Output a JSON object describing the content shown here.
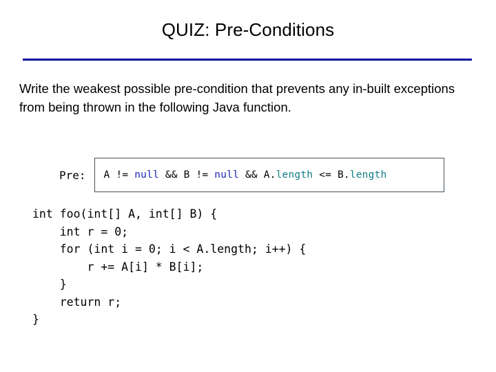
{
  "slide": {
    "title": "QUIZ: Pre-Conditions",
    "rule_color": "#0a0aa0",
    "prompt": "Write the weakest possible pre-condition that prevents any in-built exceptions from being thrown in the following Java function."
  },
  "precondition": {
    "label": "Pre:",
    "full_text": "A != null && B != null && A.length <= B.length",
    "tokens": [
      {
        "text": "A != ",
        "kind": "plain"
      },
      {
        "text": "null",
        "kind": "keyword"
      },
      {
        "text": " && B != ",
        "kind": "plain"
      },
      {
        "text": "null",
        "kind": "keyword"
      },
      {
        "text": " && A.",
        "kind": "plain"
      },
      {
        "text": "length",
        "kind": "member"
      },
      {
        "text": " <= B.",
        "kind": "plain"
      },
      {
        "text": "length",
        "kind": "member"
      }
    ],
    "colors": {
      "plain": "#000000",
      "keyword": "#1b26b4",
      "member": "#0f7c85",
      "border": "#44525c"
    }
  },
  "code": {
    "language": "Java",
    "lines": [
      "int foo(int[] A, int[] B) {",
      "    int r = 0;",
      "    for (int i = 0; i < A.length; i++) {",
      "        r += A[i] * B[i];",
      "    }",
      "    return r;",
      "}"
    ]
  }
}
